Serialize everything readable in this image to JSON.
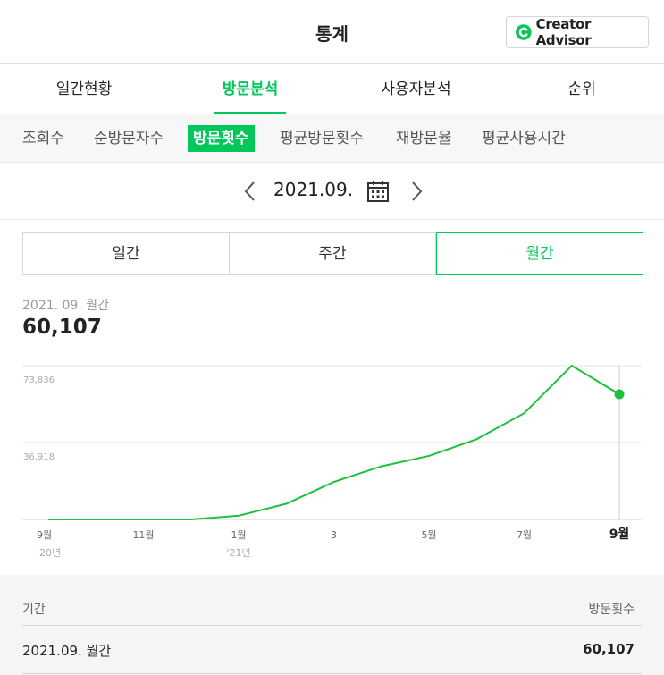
{
  "header": {
    "title": "통계",
    "creator_advisor_label": "Creator Advisor"
  },
  "main_tabs": [
    {
      "label": "일간현황",
      "active": false
    },
    {
      "label": "방문분석",
      "active": true
    },
    {
      "label": "사용자분석",
      "active": false
    },
    {
      "label": "순위",
      "active": false
    }
  ],
  "sub_tabs": [
    {
      "label": "조회수",
      "active": false
    },
    {
      "label": "순방문자수",
      "active": false
    },
    {
      "label": "방문횟수",
      "active": true
    },
    {
      "label": "평균방문횟수",
      "active": false
    },
    {
      "label": "재방문율",
      "active": false
    },
    {
      "label": "평균사용시간",
      "active": false
    }
  ],
  "date_nav": {
    "current": "2021.09."
  },
  "period_tabs": [
    {
      "label": "일간",
      "active": false
    },
    {
      "label": "주간",
      "active": false
    },
    {
      "label": "월간",
      "active": true
    }
  ],
  "summary": {
    "label": "2021. 09. 월간",
    "value": "60,107"
  },
  "chart_data": {
    "type": "line",
    "x": [
      "2020-09",
      "2020-10",
      "2020-11",
      "2020-12",
      "2021-01",
      "2021-02",
      "2021-03",
      "2021-04",
      "2021-05",
      "2021-06",
      "2021-07",
      "2021-08",
      "2021-09"
    ],
    "values": [
      0,
      0,
      0,
      0,
      1800,
      7500,
      18000,
      25500,
      30500,
      38500,
      51000,
      73836,
      60107
    ],
    "tick_labels": [
      {
        "index": 0,
        "label": "9월",
        "sublabel": "'20년"
      },
      {
        "index": 2,
        "label": "11월"
      },
      {
        "index": 4,
        "label": "1월",
        "sublabel": "'21년"
      },
      {
        "index": 6,
        "label": "3"
      },
      {
        "index": 8,
        "label": "5월"
      },
      {
        "index": 10,
        "label": "7월"
      },
      {
        "index": 12,
        "label": "9월",
        "bold": true
      }
    ],
    "y_gridlines": [
      {
        "value": 73836,
        "label": "73,836"
      },
      {
        "value": 36918,
        "label": "36,918"
      }
    ],
    "ylim": [
      0,
      73836
    ],
    "highlight_index": 12,
    "line_color": "#1fbf3f",
    "grid": true
  },
  "table": {
    "headers": [
      "기간",
      "방문횟수"
    ],
    "rows": [
      [
        "2021.09. 월간",
        "60,107"
      ]
    ]
  },
  "colors": {
    "accent": "#03c75a"
  }
}
